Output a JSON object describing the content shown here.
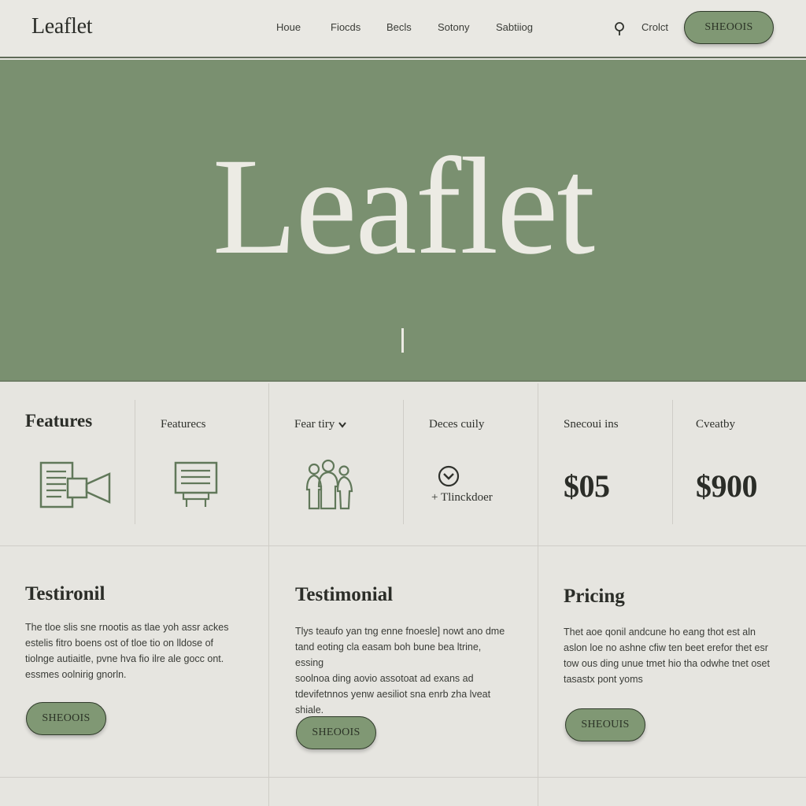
{
  "header": {
    "logo": "Leaflet",
    "nav": [
      "Houe",
      "Fiocds",
      "Becls",
      "Sotony",
      "Sabtiiog"
    ],
    "search_icon": "search-icon",
    "contact": "Crolct",
    "cta": "SHEOOIS"
  },
  "hero": {
    "title": "Leaflet"
  },
  "features": {
    "main_heading": "Features",
    "columns": [
      {
        "heading": "Featurecs",
        "icon": "document-icon"
      },
      {
        "heading": "Fear tiry",
        "icon": "people-icon",
        "has_dropdown": true
      },
      {
        "heading": "Deces cuily",
        "icon": "close-circle-icon",
        "link": "+ Tlinckdoer"
      },
      {
        "heading": "Snecoui ins",
        "price": "$05"
      },
      {
        "heading": "Cveatby",
        "price": "$900"
      }
    ]
  },
  "cards": [
    {
      "title": "Testironil",
      "lines": [
        "The tloe slis sne rnootis as tlae yoh assr ackes",
        "estelis fitro boens ost of tloe tio on lldose of",
        "tiolnge autiaitle, pvne hva fio ilre ale gocc ont.",
        "essmes oolnirig gnorln."
      ],
      "cta": "SHEOOIS"
    },
    {
      "title": "Testimonial",
      "lines": [
        "Tlys teaufo yan tng enne fnoesle] nowt ano dme",
        "tand eoting cla easam boh bune bea ltrine, essing",
        "soolnoa ding aovio assotoat ad exans ad",
        "tdevifetnnos yenw aesiliot sna enrb zha lveat",
        "shiale."
      ],
      "cta": "SHEOOIS"
    },
    {
      "title": "Pricing",
      "lines": [
        "Thet aoe qonil andcune ho eang thot est aln",
        "aslon loe no ashne cfiw ten beet erefor thet esr",
        "tow ous ding unue tmet hio tha odwhe tnet oset",
        "tasastx pont yoms"
      ],
      "cta": "SHEOUIS"
    }
  ],
  "colors": {
    "accent": "#809874",
    "hero_bg": "#7a9070",
    "page_bg": "#e6e5e0",
    "text": "#2b2d28"
  }
}
